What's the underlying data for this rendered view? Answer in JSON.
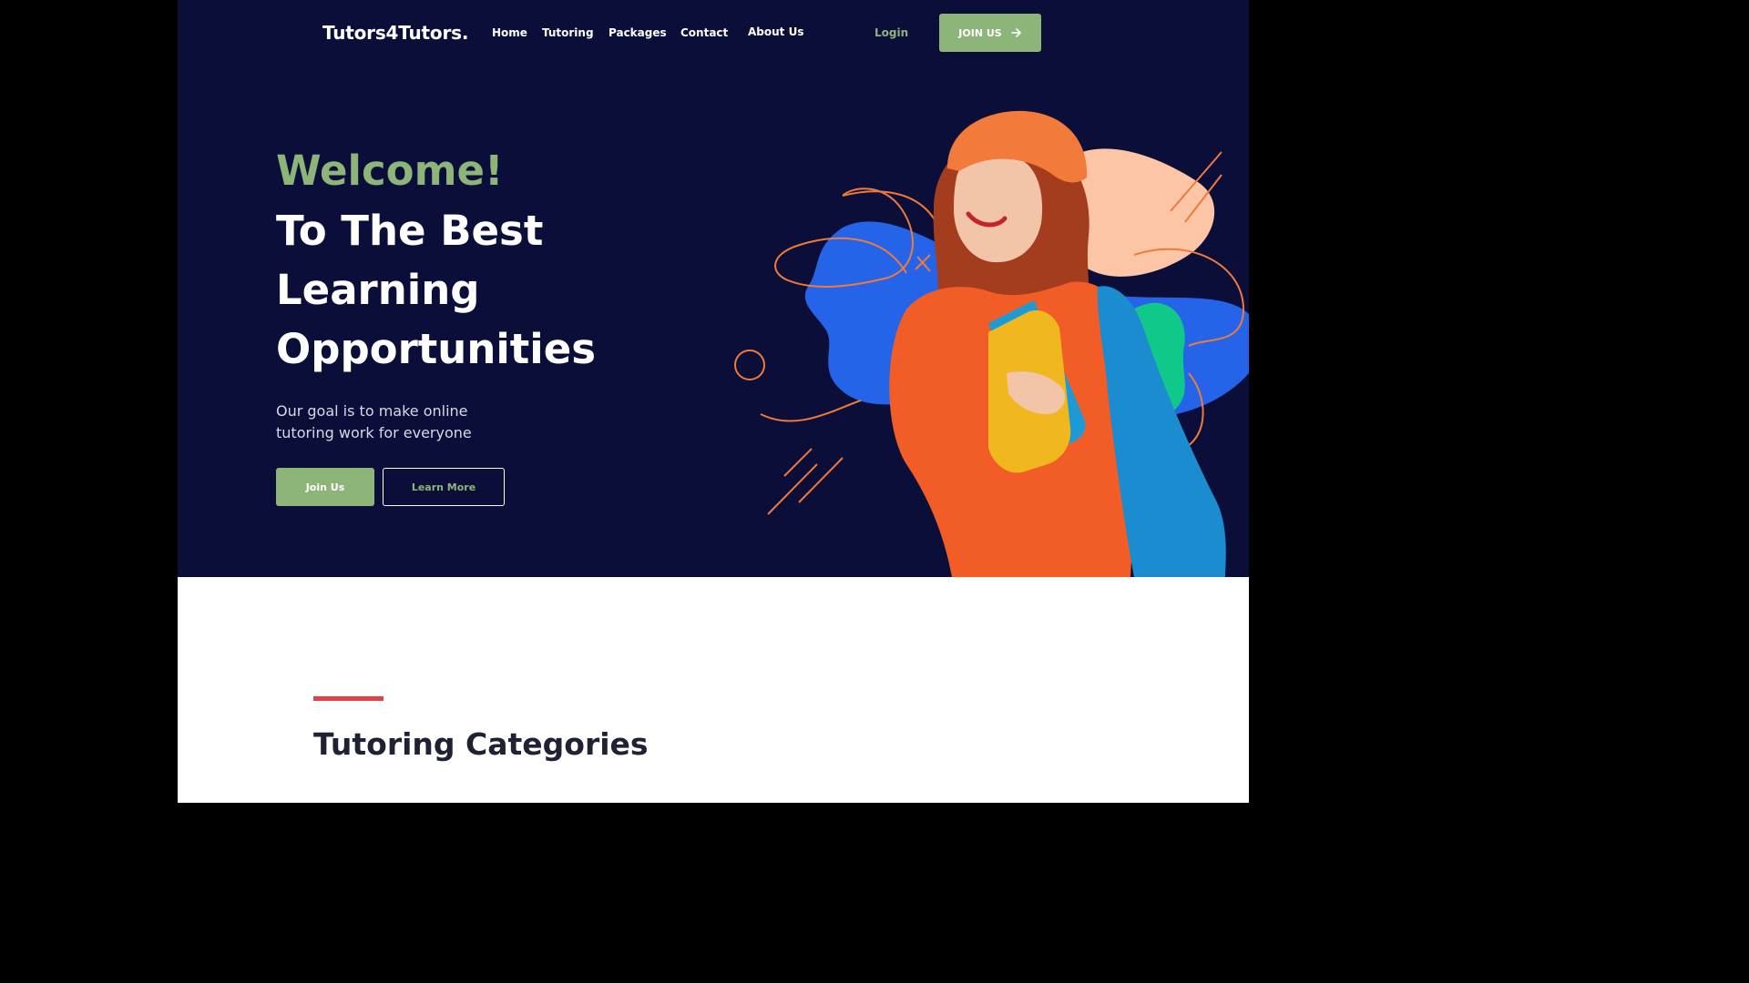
{
  "colors": {
    "hero_background": "#0a0e38",
    "accent_green": "#8db57a",
    "accent_red": "#e0424a",
    "heading_dark": "#1f2233"
  },
  "header": {
    "logo": "Tutors4Tutors.",
    "nav": [
      "Home",
      "Tutoring",
      "Packages",
      "Contact",
      "About Us"
    ],
    "login_label": "Login",
    "join_label": "JOIN US",
    "join_icon": "arrow-right-icon"
  },
  "hero": {
    "welcome": "Welcome!",
    "headline_lines": [
      "To The Best",
      "Learning",
      "Opportunities"
    ],
    "subtitle": "Our goal is to make online tutoring work for everyone",
    "primary_button": "Join Us",
    "secondary_button": "Learn More"
  },
  "categories_section": {
    "title": "Tutoring Categories"
  }
}
